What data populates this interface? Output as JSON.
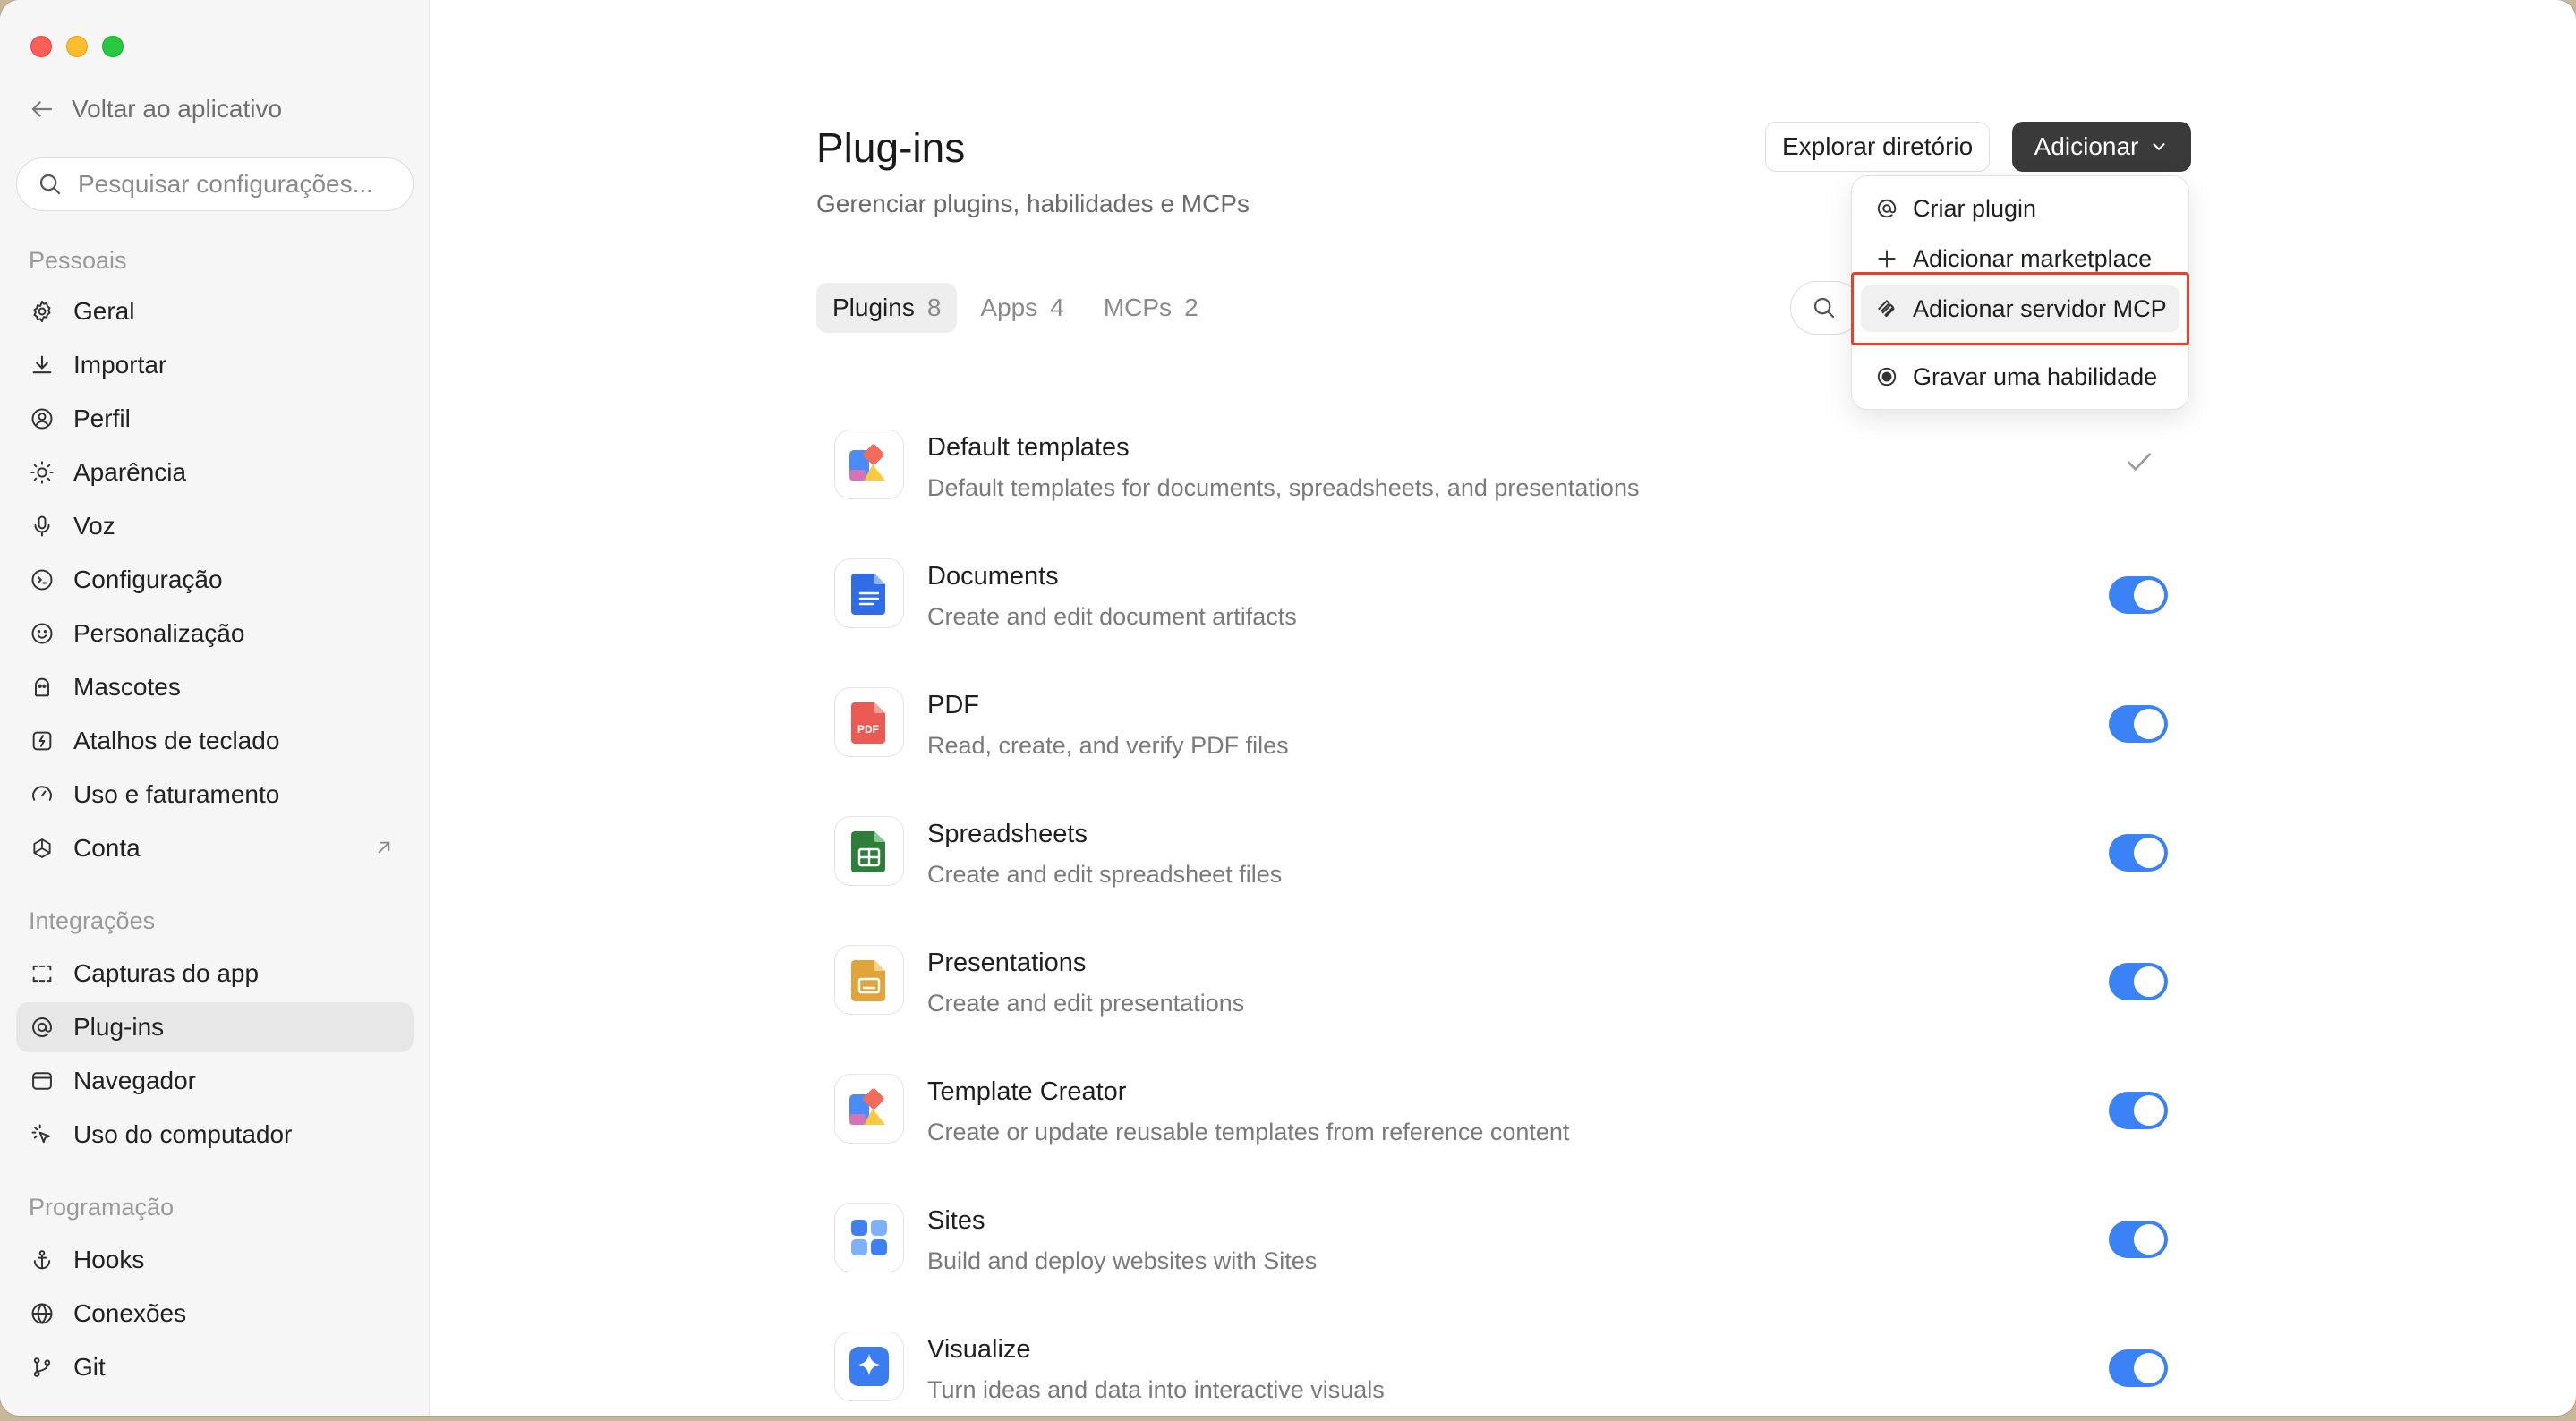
{
  "sidebar": {
    "back_label": "Voltar ao aplicativo",
    "search_placeholder": "Pesquisar configurações...",
    "sections": {
      "personal": "Pessoais",
      "integrations": "Integrações",
      "programming": "Programação"
    },
    "personal_items": [
      {
        "label": "Geral",
        "icon": "gear-icon"
      },
      {
        "label": "Importar",
        "icon": "download-icon"
      },
      {
        "label": "Perfil",
        "icon": "user-circle-icon"
      },
      {
        "label": "Aparência",
        "icon": "sun-icon"
      },
      {
        "label": "Voz",
        "icon": "microphone-icon"
      },
      {
        "label": "Configuração",
        "icon": "terminal-icon"
      },
      {
        "label": "Personalização",
        "icon": "smile-icon"
      },
      {
        "label": "Mascotes",
        "icon": "mascot-icon"
      },
      {
        "label": "Atalhos de teclado",
        "icon": "keyboard-icon"
      },
      {
        "label": "Uso e faturamento",
        "icon": "gauge-icon"
      },
      {
        "label": "Conta",
        "icon": "openai-icon"
      }
    ],
    "integration_items": [
      {
        "label": "Capturas do app",
        "icon": "screenshot-icon"
      },
      {
        "label": "Plug-ins",
        "icon": "at-icon"
      },
      {
        "label": "Navegador",
        "icon": "browser-icon"
      },
      {
        "label": "Uso do computador",
        "icon": "cursor-icon"
      }
    ],
    "programming_items": [
      {
        "label": "Hooks",
        "icon": "anchor-icon"
      },
      {
        "label": "Conexões",
        "icon": "globe-icon"
      },
      {
        "label": "Git",
        "icon": "branch-icon"
      }
    ]
  },
  "header": {
    "title": "Plug-ins",
    "subtitle": "Gerenciar plugins, habilidades e MCPs",
    "explore_label": "Explorar diretório",
    "add_label": "Adicionar"
  },
  "tabs": [
    {
      "label": "Plugins",
      "count": "8"
    },
    {
      "label": "Apps",
      "count": "4"
    },
    {
      "label": "MCPs",
      "count": "2"
    }
  ],
  "plugins": [
    {
      "name": "Default templates",
      "desc": "Default templates for documents, spreadsheets, and presentations",
      "state": "check"
    },
    {
      "name": "Documents",
      "desc": "Create and edit document artifacts",
      "state": "on"
    },
    {
      "name": "PDF",
      "desc": "Read, create, and verify PDF files",
      "state": "on"
    },
    {
      "name": "Spreadsheets",
      "desc": "Create and edit spreadsheet files",
      "state": "on"
    },
    {
      "name": "Presentations",
      "desc": "Create and edit presentations",
      "state": "on"
    },
    {
      "name": "Template Creator",
      "desc": "Create or update reusable templates from reference content",
      "state": "on"
    },
    {
      "name": "Sites",
      "desc": "Build and deploy websites with Sites",
      "state": "on"
    },
    {
      "name": "Visualize",
      "desc": "Turn ideas and data into interactive visuals",
      "state": "on"
    }
  ],
  "pdf_icon_text": "PDF",
  "dropdown": {
    "items": [
      {
        "label": "Criar plugin",
        "icon": "at-icon"
      },
      {
        "label": "Adicionar marketplace",
        "icon": "plus-icon"
      },
      {
        "label": "Adicionar servidor MCP",
        "icon": "mcp-icon"
      },
      {
        "label": "Gravar uma habilidade",
        "icon": "record-icon"
      }
    ]
  },
  "colors": {
    "toggle_on": "#3b82f6",
    "add_button": "#3a3a3a",
    "highlight": "#e0432f"
  }
}
